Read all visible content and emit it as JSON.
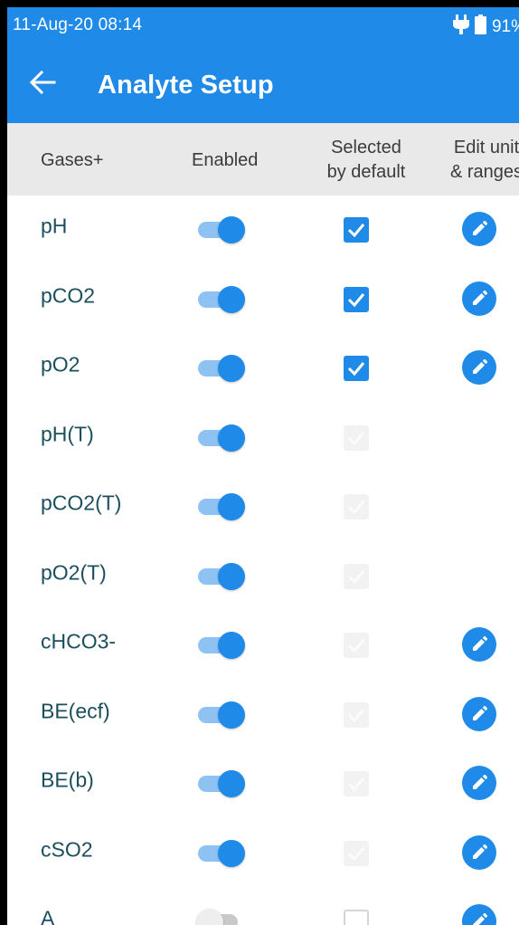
{
  "status_bar": {
    "time": "11-Aug-20 08:14",
    "battery": "91%",
    "icons": [
      "charging-plug-icon",
      "battery-icon"
    ]
  },
  "app_bar": {
    "title": "Analyte Setup",
    "back_icon": "arrow-back-icon"
  },
  "table": {
    "headers": {
      "analyte": "Gases+",
      "enabled": "Enabled",
      "selected_line1": "Selected",
      "selected_line2": "by default",
      "edit_line1": "Edit unit",
      "edit_line2": "& ranges"
    },
    "rows": [
      {
        "name": "pH",
        "enabled": true,
        "selected": "checked",
        "editable": true
      },
      {
        "name": "pCO2",
        "enabled": true,
        "selected": "checked",
        "editable": true
      },
      {
        "name": "pO2",
        "enabled": true,
        "selected": "checked",
        "editable": true
      },
      {
        "name": "pH(T)",
        "enabled": true,
        "selected": "disabled",
        "editable": false
      },
      {
        "name": "pCO2(T)",
        "enabled": true,
        "selected": "disabled",
        "editable": false
      },
      {
        "name": "pO2(T)",
        "enabled": true,
        "selected": "disabled",
        "editable": false
      },
      {
        "name": "cHCO3-",
        "enabled": true,
        "selected": "disabled",
        "editable": true
      },
      {
        "name": "BE(ecf)",
        "enabled": true,
        "selected": "disabled",
        "editable": true
      },
      {
        "name": "BE(b)",
        "enabled": true,
        "selected": "disabled",
        "editable": true
      },
      {
        "name": "cSO2",
        "enabled": true,
        "selected": "disabled",
        "editable": true
      },
      {
        "name": "A",
        "enabled": false,
        "selected": "unchecked",
        "editable": true
      }
    ]
  },
  "colors": {
    "primary": "#1f8ae8",
    "track_on": "#8ec2f3",
    "header_bg": "#e9e9e9",
    "name_text": "#1b4f5b"
  }
}
